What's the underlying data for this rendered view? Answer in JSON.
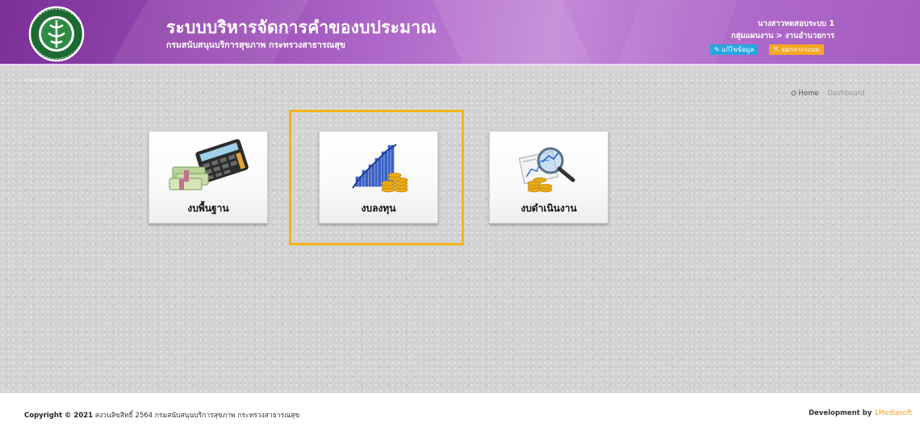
{
  "header": {
    "title": "ระบบบริหารจัดการคำของบประมาณ",
    "subtitle": "กรมสนับสนุนบริการสุขภาพ กระทรวงสาธารณสุข",
    "logo_text": "MINISTRY OF PUBLIC HEALTH",
    "user_name": "นางสาวทดสอบระบบ 1",
    "user_dept": "กลุ่มแผนงาน > งานอำนวยการ",
    "edit_label": "แก้ไขข้อมูล",
    "logout_label": "ออกจากระบบ",
    "brand_color": "#9b4cb5"
  },
  "content": {
    "dept_small": "กรมสนับสนุนบริการสุขภาพ",
    "breadcrumb": {
      "home_label": "Home",
      "current": "Dashboard"
    }
  },
  "tiles": [
    {
      "label": "งบพื้นฐาน",
      "icon": "money-calculator-icon"
    },
    {
      "label": "งบลงทุน",
      "icon": "growth-chart-coins-icon"
    },
    {
      "label": "งบดำเนินงาน",
      "icon": "magnifier-report-coins-icon"
    }
  ],
  "highlight_color": "#f7b515",
  "footer": {
    "copyright_prefix": "Copyright © 2021",
    "copyright_text": "สงวนลิขสิทธิ์ 2564 กรมสนับสนุนบริการสุขภาพ กระทรวงสาธารณสุข",
    "dev_prefix": "Development by",
    "dev_brand": "1Mediasoft"
  }
}
